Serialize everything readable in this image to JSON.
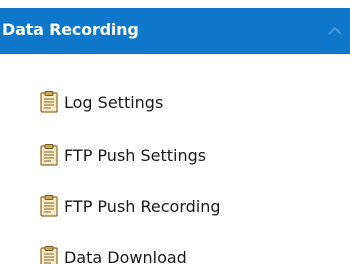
{
  "panel": {
    "title": "Data Recording",
    "header_color": "#0e77c9"
  },
  "menu": {
    "items": [
      {
        "label": "Log Settings",
        "icon": "clipboard-icon"
      },
      {
        "label": "FTP Push Settings",
        "icon": "clipboard-icon"
      },
      {
        "label": "FTP Push Recording",
        "icon": "clipboard-icon"
      },
      {
        "label": "Data Download",
        "icon": "clipboard-icon"
      }
    ]
  }
}
